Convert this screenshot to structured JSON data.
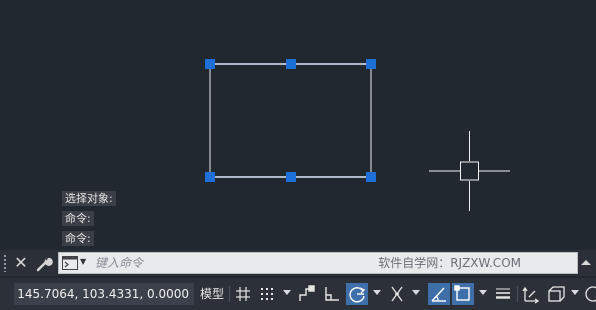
{
  "command_history": [
    "选择对象:",
    "命令:",
    "命令:"
  ],
  "command_line": {
    "placeholder": "键入命令",
    "watermark": "软件自学网：RJZXW.COM"
  },
  "status_bar": {
    "coordinates": "145.7064, 103.4331, 0.0000",
    "model_label": "模型",
    "buttons": [
      {
        "icon": "grid-icon",
        "active": false
      },
      {
        "icon": "snap-mode-icon",
        "active": false
      },
      {
        "icon": "infer-constraints-icon",
        "active": false
      },
      {
        "icon": "ortho-mode-icon",
        "active": false
      },
      {
        "icon": "polar-tracking-icon",
        "active": true
      },
      {
        "icon": "isometric-drafting-icon",
        "active": false
      },
      {
        "icon": "object-snap-tracking-icon",
        "active": true
      },
      {
        "icon": "object-snap-icon",
        "active": true
      },
      {
        "icon": "lineweight-icon",
        "active": false
      },
      {
        "icon": "transparency-icon",
        "active": false
      },
      {
        "icon": "selection-cycling-icon",
        "active": false
      },
      {
        "icon": "3d-osnap-icon",
        "active": false
      }
    ]
  },
  "colors": {
    "canvas_bg": "#212830",
    "grip": "#1f6fd8",
    "selected_line": "#5aa0ff",
    "active_button": "#3e6fa8"
  }
}
